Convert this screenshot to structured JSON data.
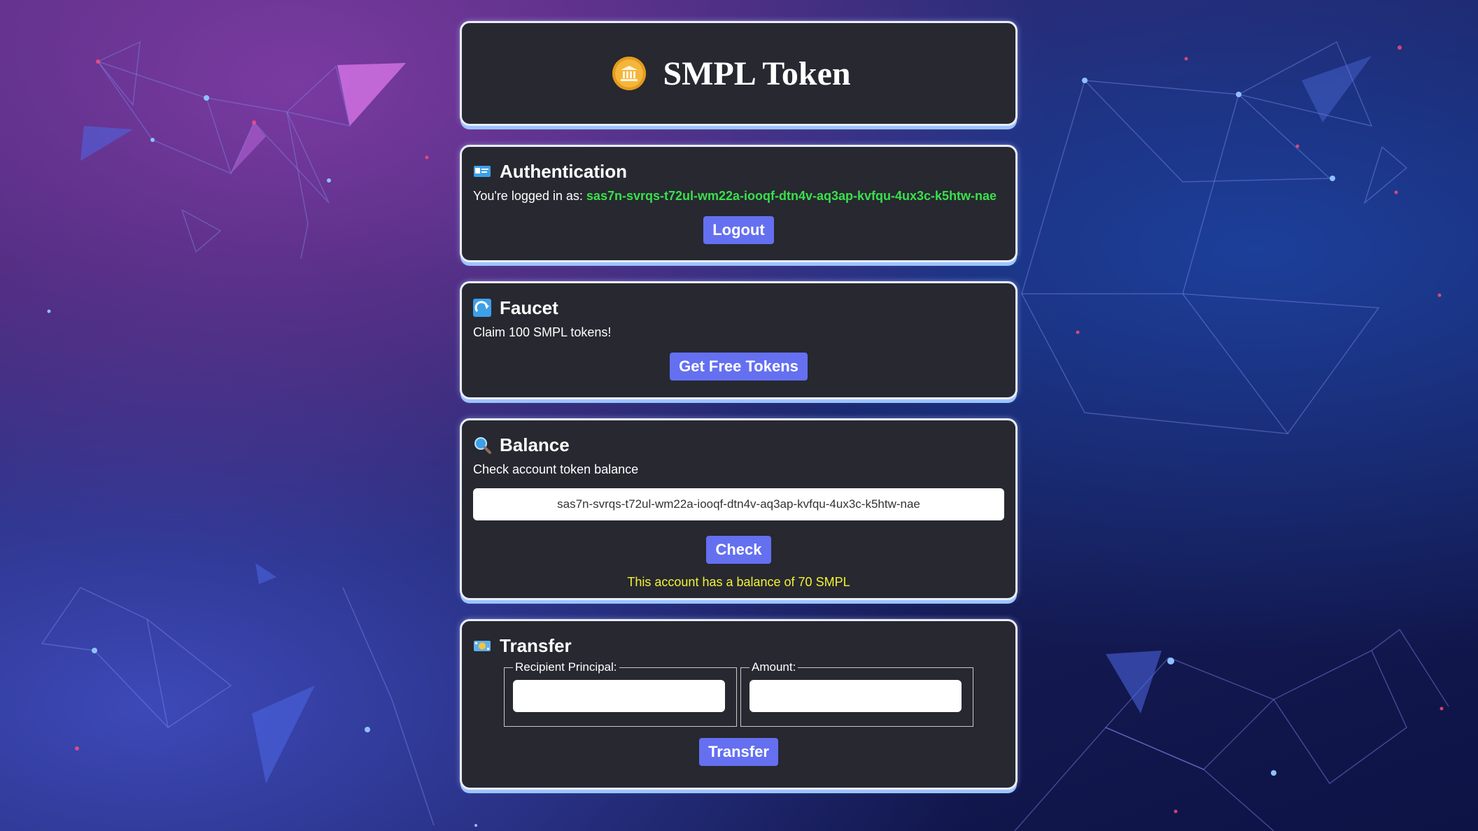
{
  "app": {
    "title": "SMPL Token",
    "icon": "bank-coin-icon",
    "accent": "#6470f0"
  },
  "auth": {
    "title": "Authentication",
    "icon": "id-card-icon",
    "logged_in_prefix": "You're logged in as:",
    "principal": "sas7n-svrqs-t72ul-wm22a-iooqf-dtn4v-aq3ap-kvfqu-4ux3c-k5htw-nae",
    "logout_label": "Logout"
  },
  "faucet": {
    "title": "Faucet",
    "icon": "faucet-icon",
    "description": "Claim 100 SMPL tokens!",
    "button_label": "Get Free Tokens"
  },
  "balance": {
    "title": "Balance",
    "icon": "magnifier-icon",
    "description": "Check account token balance",
    "input_value": "sas7n-svrqs-t72ul-wm22a-iooqf-dtn4v-aq3ap-kvfqu-4ux3c-k5htw-nae",
    "button_label": "Check",
    "result": "This account has a balance of 70 SMPL"
  },
  "transfer": {
    "title": "Transfer",
    "icon": "money-bill-icon",
    "recipient_label": "Recipient Principal:",
    "recipient_value": "",
    "amount_label": "Amount:",
    "amount_value": "",
    "button_label": "Transfer"
  }
}
